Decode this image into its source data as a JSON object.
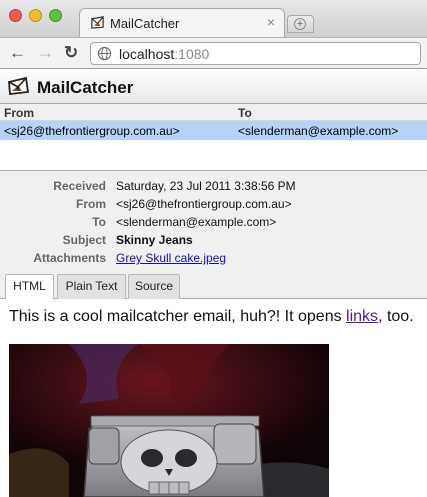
{
  "browser": {
    "tab_title": "MailCatcher",
    "tab_close_glyph": "×",
    "url_host": "localhost",
    "url_port": ":1080",
    "icons": {
      "back": "arrow-left-icon",
      "forward": "arrow-right-icon",
      "reload": "reload-icon",
      "close": "close-icon",
      "new_tab": "plus-icon",
      "page": "globe-icon"
    },
    "nav_glyphs": {
      "back": "←",
      "forward": "→",
      "reload": "↻",
      "new_tab": "+"
    },
    "colors": {
      "close": "#ee5a52",
      "minimize": "#f5bd2e",
      "zoom": "#5fc23f"
    }
  },
  "app": {
    "title": "MailCatcher"
  },
  "message_list": {
    "headers": {
      "from": "From",
      "to": "To"
    },
    "rows": [
      {
        "from": "<sj26@thefrontiergroup.com.au>",
        "to": "<slenderman@example.com>",
        "selected": true
      }
    ]
  },
  "message_meta": {
    "received": {
      "label": "Received",
      "value": "Saturday, 23 Jul 2011 3:38:56 PM"
    },
    "from": {
      "label": "From",
      "value": "<sj26@thefrontiergroup.com.au>"
    },
    "to": {
      "label": "To",
      "value": "<slenderman@example.com>"
    },
    "subject": {
      "label": "Subject",
      "value": "Skinny Jeans"
    },
    "attachments": {
      "label": "Attachments",
      "value": "Grey Skull cake.jpeg"
    }
  },
  "format_tabs": [
    {
      "label": "HTML",
      "active": true
    },
    {
      "label": "Plain Text",
      "active": false
    },
    {
      "label": "Source",
      "active": false
    }
  ],
  "message_body": {
    "text_before": "This is a cool mailcatcher email, huh?! It opens ",
    "link_text": "links",
    "text_after": ", too."
  },
  "selection_color": "#b6d2f7"
}
